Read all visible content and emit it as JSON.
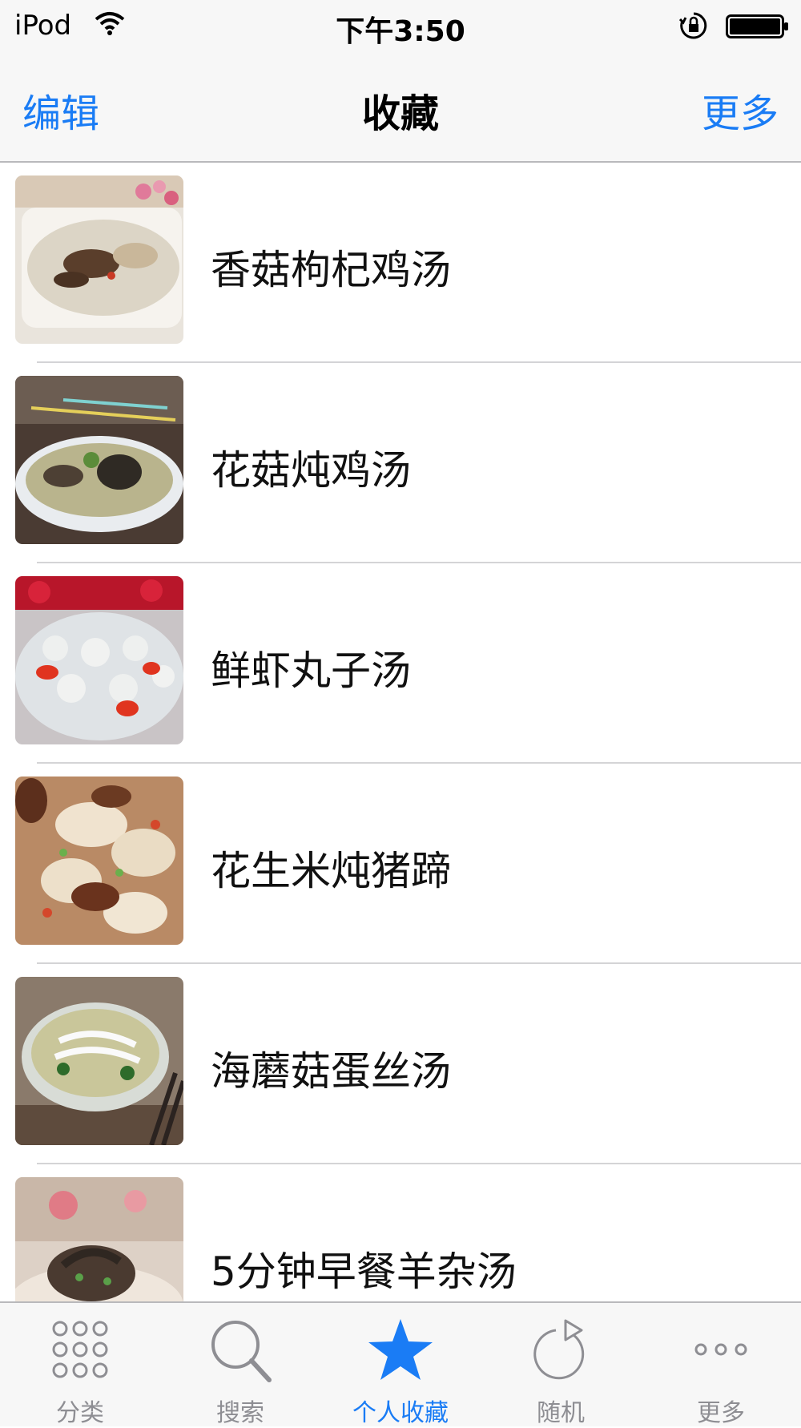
{
  "status_bar": {
    "carrier": "iPod",
    "time": "下午3:50"
  },
  "nav": {
    "left_button": "编辑",
    "title": "收藏",
    "right_button": "更多"
  },
  "favorites": [
    {
      "label": "香菇枸杞鸡汤"
    },
    {
      "label": "花菇炖鸡汤"
    },
    {
      "label": "鲜虾丸子汤"
    },
    {
      "label": "花生米炖猪蹄"
    },
    {
      "label": "海蘑菇蛋丝汤"
    },
    {
      "label": "5分钟早餐羊杂汤"
    }
  ],
  "tabs": [
    {
      "label": "分类",
      "icon": "grid-icon",
      "active": false
    },
    {
      "label": "搜索",
      "icon": "search-icon",
      "active": false
    },
    {
      "label": "个人收藏",
      "icon": "star-icon",
      "active": true
    },
    {
      "label": "随机",
      "icon": "refresh-icon",
      "active": false
    },
    {
      "label": "更多",
      "icon": "more-dots-icon",
      "active": false
    }
  ],
  "colors": {
    "accent": "#1a7cf5",
    "inactive": "#8e8e93"
  }
}
